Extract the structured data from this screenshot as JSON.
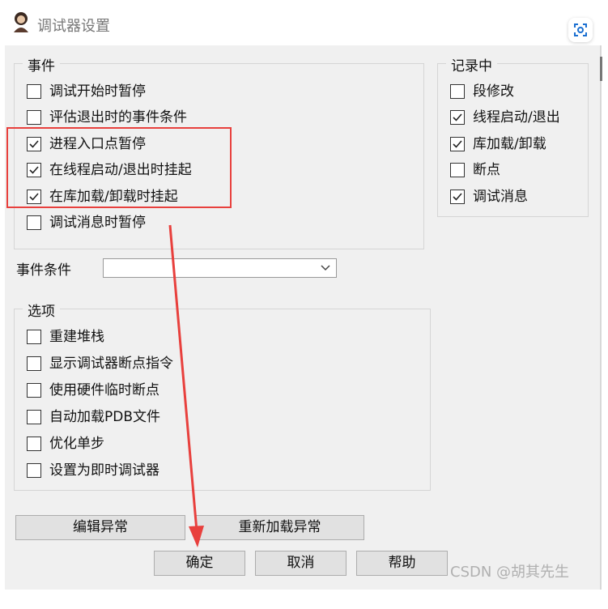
{
  "window": {
    "title": "调试器设置"
  },
  "events": {
    "legend": "事件",
    "items": [
      {
        "label": "调试开始时暂停",
        "checked": false
      },
      {
        "label": "评估退出时的事件条件",
        "checked": false
      },
      {
        "label": "进程入口点暂停",
        "checked": true
      },
      {
        "label": "在线程启动/退出时挂起",
        "checked": true
      },
      {
        "label": "在库加载/卸载时挂起",
        "checked": true
      },
      {
        "label": "调试消息时暂停",
        "checked": false
      }
    ]
  },
  "recording": {
    "legend": "记录中",
    "items": [
      {
        "label": "段修改",
        "checked": false
      },
      {
        "label": "线程启动/退出",
        "checked": true
      },
      {
        "label": "库加载/卸载",
        "checked": true
      },
      {
        "label": "断点",
        "checked": false
      },
      {
        "label": "调试消息",
        "checked": true
      }
    ]
  },
  "event_condition": {
    "label": "事件条件",
    "value": ""
  },
  "options": {
    "legend": "选项",
    "items": [
      {
        "label": "重建堆栈",
        "checked": false
      },
      {
        "label": "显示调试器断点指令",
        "checked": false
      },
      {
        "label": "使用硬件临时断点",
        "checked": false
      },
      {
        "label": "自动加载PDB文件",
        "checked": false
      },
      {
        "label": "优化单步",
        "checked": false
      },
      {
        "label": "设置为即时调试器",
        "checked": false
      }
    ]
  },
  "buttons": {
    "edit_exceptions": "编辑异常",
    "reload_exceptions": "重新加载异常",
    "ok": "确定",
    "cancel": "取消",
    "help": "帮助"
  },
  "watermark": "CSDN @胡其先生",
  "colors": {
    "annotation": "#e8403d",
    "dialog_bg": "#f0f0f0"
  },
  "icons": [
    "app-avatar-icon",
    "scan-icon",
    "checkmark-icon",
    "chevron-down-icon"
  ]
}
